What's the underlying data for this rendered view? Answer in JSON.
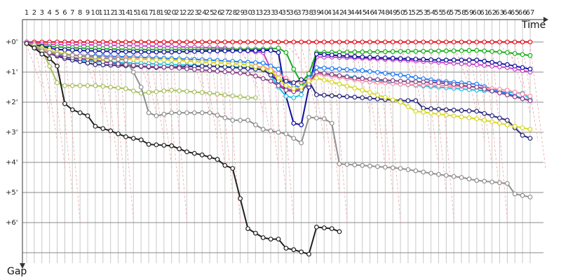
{
  "chart_data": {
    "type": "line",
    "title": "",
    "xlabel": "Time",
    "ylabel": "Gap",
    "x_ticks": [
      "1",
      "2",
      "3",
      "4",
      "5",
      "6",
      "7",
      "8",
      "9",
      "10",
      "11",
      "12",
      "13",
      "14",
      "15",
      "16",
      "17",
      "18",
      "19",
      "20",
      "21",
      "22",
      "23",
      "24",
      "25",
      "26",
      "27",
      "28",
      "29",
      "30",
      "31",
      "32",
      "33",
      "34",
      "35",
      "36",
      "37",
      "38",
      "39",
      "40",
      "41",
      "42",
      "43",
      "44",
      "45",
      "46",
      "47",
      "48",
      "49",
      "50",
      "51",
      "52",
      "53",
      "54",
      "55",
      "56",
      "57",
      "58",
      "59",
      "60",
      "61",
      "62",
      "63",
      "64",
      "65",
      "66",
      "67"
    ],
    "y_ticks": [
      "+0'",
      "+1'",
      "+2'",
      "+3'",
      "+4'",
      "+5'",
      "+6'"
    ],
    "xlim": [
      1,
      67
    ],
    "ylim": [
      0,
      7.5
    ],
    "grid": true,
    "y_inverted": true,
    "series": [
      {
        "color": "#e8101a",
        "points": [
          [
            1,
            0
          ],
          [
            2,
            0
          ],
          [
            4,
            0
          ],
          [
            10,
            0
          ],
          [
            20,
            0
          ],
          [
            30,
            0
          ],
          [
            40,
            0
          ],
          [
            50,
            0
          ],
          [
            60,
            0
          ],
          [
            67,
            0
          ]
        ]
      },
      {
        "color": "#cc44cc",
        "points": [
          [
            1,
            0
          ],
          [
            2,
            0.05
          ],
          [
            4,
            0.08
          ],
          [
            10,
            0.1
          ],
          [
            20,
            0.15
          ],
          [
            27,
            0.2
          ],
          [
            30,
            0.3
          ],
          [
            32,
            0.35
          ],
          [
            33,
            0.9
          ],
          [
            34,
            1.4
          ],
          [
            35,
            1.55
          ],
          [
            36,
            1.6
          ],
          [
            37,
            1.55
          ],
          [
            38,
            1.45
          ],
          [
            39,
            0.5
          ],
          [
            41,
            0.5
          ],
          [
            50,
            0.6
          ],
          [
            60,
            0.75
          ],
          [
            64,
            0.85
          ],
          [
            67,
            1.0
          ]
        ]
      },
      {
        "color": "#1aae1a",
        "points": [
          [
            1,
            0.05
          ],
          [
            2,
            0.1
          ],
          [
            4,
            0.15
          ],
          [
            8,
            0.2
          ],
          [
            15,
            0.25
          ],
          [
            25,
            0.25
          ],
          [
            33,
            0.23
          ],
          [
            34,
            0.2
          ],
          [
            35,
            0.35
          ],
          [
            36,
            0.9
          ],
          [
            37,
            1.35
          ],
          [
            38,
            1.05
          ],
          [
            39,
            0.35
          ],
          [
            45,
            0.33
          ],
          [
            55,
            0.3
          ],
          [
            60,
            0.28
          ],
          [
            64,
            0.35
          ],
          [
            67,
            0.45
          ]
        ]
      },
      {
        "color": "#1010a0",
        "points": [
          [
            1,
            0.05
          ],
          [
            2,
            0.1
          ],
          [
            5,
            0.25
          ],
          [
            10,
            0.3
          ],
          [
            15,
            0.33
          ],
          [
            20,
            0.33
          ],
          [
            25,
            0.3
          ],
          [
            33,
            0.28
          ],
          [
            34,
            0.35
          ],
          [
            35,
            1.8
          ],
          [
            36,
            2.7
          ],
          [
            37,
            2.75
          ],
          [
            38,
            1.5
          ],
          [
            39,
            0.4
          ],
          [
            45,
            0.5
          ],
          [
            55,
            0.6
          ],
          [
            60,
            0.6
          ],
          [
            64,
            0.75
          ],
          [
            67,
            0.9
          ]
        ]
      },
      {
        "color": "#20c0e0",
        "points": [
          [
            1,
            0.05
          ],
          [
            3,
            0.2
          ],
          [
            6,
            0.5
          ],
          [
            8,
            0.6
          ],
          [
            10,
            0.65
          ],
          [
            20,
            0.75
          ],
          [
            30,
            0.85
          ],
          [
            32,
            0.9
          ],
          [
            33,
            1.1
          ],
          [
            34,
            1.5
          ],
          [
            35,
            1.8
          ],
          [
            36,
            1.85
          ],
          [
            37,
            1.75
          ],
          [
            38,
            1.2
          ],
          [
            39,
            1.05
          ],
          [
            45,
            1.2
          ],
          [
            50,
            1.4
          ],
          [
            60,
            1.6
          ],
          [
            66,
            1.7
          ],
          [
            67,
            1.9
          ]
        ]
      },
      {
        "color": "#2080ff",
        "points": [
          [
            1,
            0.05
          ],
          [
            3,
            0.2
          ],
          [
            5,
            0.4
          ],
          [
            8,
            0.45
          ],
          [
            15,
            0.5
          ],
          [
            20,
            0.55
          ],
          [
            25,
            0.6
          ],
          [
            32,
            0.7
          ],
          [
            34,
            0.9
          ],
          [
            35,
            1.3
          ],
          [
            36,
            1.45
          ],
          [
            37,
            1.5
          ],
          [
            38,
            1.2
          ],
          [
            39,
            0.85
          ],
          [
            45,
            0.95
          ],
          [
            50,
            1.1
          ],
          [
            55,
            1.3
          ],
          [
            60,
            1.4
          ],
          [
            67,
            1.95
          ]
        ]
      },
      {
        "color": "#ff8fa8",
        "points": [
          [
            1,
            0.05
          ],
          [
            3,
            0.25
          ],
          [
            6,
            0.4
          ],
          [
            10,
            0.5
          ],
          [
            15,
            0.55
          ],
          [
            20,
            0.6
          ],
          [
            30,
            0.75
          ],
          [
            33,
            0.9
          ],
          [
            35,
            1.2
          ],
          [
            36,
            1.35
          ],
          [
            37,
            1.3
          ],
          [
            38,
            1.25
          ],
          [
            39,
            1.05
          ],
          [
            45,
            1.3
          ],
          [
            50,
            1.4
          ],
          [
            55,
            1.45
          ],
          [
            60,
            1.5
          ],
          [
            64,
            1.6
          ],
          [
            67,
            1.8
          ]
        ]
      },
      {
        "color": "#2a2a80",
        "points": [
          [
            1,
            0.05
          ],
          [
            3,
            0.3
          ],
          [
            6,
            0.55
          ],
          [
            10,
            0.75
          ],
          [
            15,
            0.8
          ],
          [
            18,
            0.85
          ],
          [
            25,
            0.8
          ],
          [
            30,
            0.88
          ],
          [
            32,
            0.92
          ],
          [
            33,
            1.1
          ],
          [
            34,
            1.3
          ],
          [
            35,
            1.3
          ],
          [
            36,
            1.35
          ],
          [
            37,
            1.25
          ],
          [
            38,
            1.3
          ],
          [
            39,
            1.75
          ],
          [
            45,
            1.85
          ],
          [
            50,
            1.95
          ],
          [
            52,
            1.95
          ],
          [
            53,
            2.2
          ],
          [
            56,
            2.25
          ],
          [
            60,
            2.3
          ],
          [
            64,
            2.6
          ],
          [
            66,
            3.1
          ],
          [
            67,
            3.2
          ]
        ]
      },
      {
        "color": "#884488",
        "points": [
          [
            1,
            0.05
          ],
          [
            3,
            0.3
          ],
          [
            6,
            0.5
          ],
          [
            8,
            0.55
          ],
          [
            10,
            0.6
          ],
          [
            12,
            0.7
          ],
          [
            14,
            0.75
          ],
          [
            16,
            0.8
          ],
          [
            20,
            0.85
          ],
          [
            30,
            1.05
          ],
          [
            33,
            1.3
          ],
          [
            35,
            1.6
          ],
          [
            36,
            1.65
          ],
          [
            37,
            1.6
          ],
          [
            38,
            1.4
          ],
          [
            39,
            1.0
          ],
          [
            44,
            1.2
          ],
          [
            50,
            1.3
          ],
          [
            55,
            1.35
          ],
          [
            60,
            1.5
          ],
          [
            67,
            1.95
          ]
        ]
      },
      {
        "color": "#d8d820",
        "points": [
          [
            1,
            0.05
          ],
          [
            3,
            0.2
          ],
          [
            5,
            0.35
          ],
          [
            10,
            0.55
          ],
          [
            20,
            0.6
          ],
          [
            30,
            0.75
          ],
          [
            33,
            0.95
          ],
          [
            35,
            1.45
          ],
          [
            36,
            1.55
          ],
          [
            37,
            1.5
          ],
          [
            38,
            1.3
          ],
          [
            39,
            1.2
          ],
          [
            45,
            1.6
          ],
          [
            50,
            2.0
          ],
          [
            52,
            2.3
          ],
          [
            60,
            2.55
          ],
          [
            64,
            2.75
          ],
          [
            67,
            2.9
          ]
        ]
      },
      {
        "color": "#a8c060",
        "points": [
          [
            1,
            0.05
          ],
          [
            2,
            0.1
          ],
          [
            3,
            0.25
          ],
          [
            4,
            0.8
          ],
          [
            5,
            1.35
          ],
          [
            6,
            1.45
          ],
          [
            10,
            1.45
          ],
          [
            14,
            1.55
          ],
          [
            16,
            1.7
          ],
          [
            20,
            1.6
          ],
          [
            25,
            1.7
          ],
          [
            30,
            1.85
          ],
          [
            31,
            1.85
          ]
        ]
      },
      {
        "color": "#909090",
        "points": [
          [
            1,
            0.05
          ],
          [
            3,
            0.3
          ],
          [
            5,
            0.4
          ],
          [
            10,
            0.5
          ],
          [
            14,
            0.6
          ],
          [
            15,
            1.0
          ],
          [
            16,
            1.5
          ],
          [
            17,
            2.35
          ],
          [
            18,
            2.45
          ],
          [
            20,
            2.35
          ],
          [
            25,
            2.35
          ],
          [
            28,
            2.6
          ],
          [
            30,
            2.6
          ],
          [
            32,
            2.9
          ],
          [
            34,
            3.0
          ],
          [
            35,
            3.05
          ],
          [
            36,
            3.2
          ],
          [
            37,
            3.35
          ],
          [
            38,
            2.5
          ],
          [
            40,
            2.55
          ],
          [
            41,
            2.7
          ],
          [
            42,
            4.05
          ],
          [
            45,
            4.1
          ],
          [
            50,
            4.2
          ],
          [
            55,
            4.4
          ],
          [
            58,
            4.5
          ],
          [
            60,
            4.6
          ],
          [
            64,
            4.7
          ],
          [
            65,
            5.05
          ],
          [
            67,
            5.15
          ]
        ]
      },
      {
        "color": "#202020",
        "points": [
          [
            1,
            0.05
          ],
          [
            2,
            0.2
          ],
          [
            3,
            0.4
          ],
          [
            4,
            0.55
          ],
          [
            5,
            0.8
          ],
          [
            6,
            2.05
          ],
          [
            7,
            2.25
          ],
          [
            8,
            2.35
          ],
          [
            9,
            2.45
          ],
          [
            10,
            2.8
          ],
          [
            12,
            2.95
          ],
          [
            14,
            3.15
          ],
          [
            16,
            3.25
          ],
          [
            17,
            3.4
          ],
          [
            20,
            3.45
          ],
          [
            22,
            3.65
          ],
          [
            24,
            3.75
          ],
          [
            26,
            3.9
          ],
          [
            27,
            4.1
          ],
          [
            28,
            4.2
          ],
          [
            29,
            5.2
          ],
          [
            30,
            6.2
          ],
          [
            31,
            6.35
          ],
          [
            32,
            6.5
          ],
          [
            33,
            6.55
          ],
          [
            34,
            6.55
          ],
          [
            35,
            6.85
          ],
          [
            36,
            6.9
          ],
          [
            38,
            7.05
          ],
          [
            39,
            6.15
          ],
          [
            41,
            6.2
          ],
          [
            42,
            6.3
          ]
        ]
      }
    ]
  }
}
